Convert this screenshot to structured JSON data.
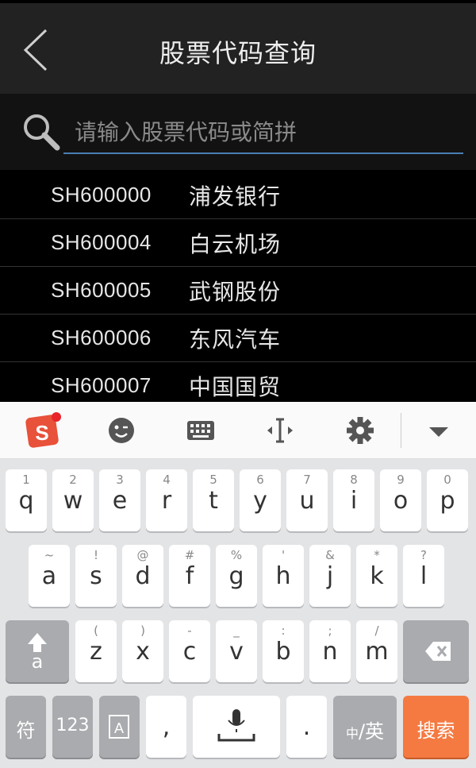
{
  "header": {
    "title": "股票代码查询"
  },
  "search": {
    "placeholder": "请输入股票代码或简拼"
  },
  "stocks": [
    {
      "code": "SH600000",
      "name": "浦发银行"
    },
    {
      "code": "SH600004",
      "name": "白云机场"
    },
    {
      "code": "SH600005",
      "name": "武钢股份"
    },
    {
      "code": "SH600006",
      "name": "东风汽车"
    },
    {
      "code": "SH600007",
      "name": "中国国贸"
    }
  ],
  "keyboard": {
    "toolbar_icons": [
      "sogou-logo-icon",
      "emoji-icon",
      "keyboard-icon",
      "cursor-icon",
      "settings-icon",
      "hide-keyboard-icon"
    ],
    "row1": [
      {
        "key": "q",
        "hint": "1"
      },
      {
        "key": "w",
        "hint": "2"
      },
      {
        "key": "e",
        "hint": "3"
      },
      {
        "key": "r",
        "hint": "4"
      },
      {
        "key": "t",
        "hint": "5"
      },
      {
        "key": "y",
        "hint": "6"
      },
      {
        "key": "u",
        "hint": "7"
      },
      {
        "key": "i",
        "hint": "8"
      },
      {
        "key": "o",
        "hint": "9"
      },
      {
        "key": "p",
        "hint": "0"
      }
    ],
    "row2": [
      {
        "key": "a",
        "hint": "~"
      },
      {
        "key": "s",
        "hint": "!"
      },
      {
        "key": "d",
        "hint": "@"
      },
      {
        "key": "f",
        "hint": "#"
      },
      {
        "key": "g",
        "hint": "%"
      },
      {
        "key": "h",
        "hint": "'"
      },
      {
        "key": "j",
        "hint": "&"
      },
      {
        "key": "k",
        "hint": "*"
      },
      {
        "key": "l",
        "hint": "?"
      }
    ],
    "row3": [
      {
        "key": "z",
        "hint": "("
      },
      {
        "key": "x",
        "hint": ")"
      },
      {
        "key": "c",
        "hint": "-"
      },
      {
        "key": "v",
        "hint": "_"
      },
      {
        "key": "b",
        "hint": ":"
      },
      {
        "key": "n",
        "hint": ";"
      },
      {
        "key": "m",
        "hint": "/"
      }
    ],
    "shift_label": "a",
    "symbol_label": "符",
    "number_label": "123",
    "comma_label": ",",
    "period_label": ".",
    "lang_label_small": "中",
    "lang_label_big": "/英",
    "search_label": "搜索"
  },
  "colors": {
    "accent_search": "#f47a42",
    "underline": "#4a7fb3"
  }
}
